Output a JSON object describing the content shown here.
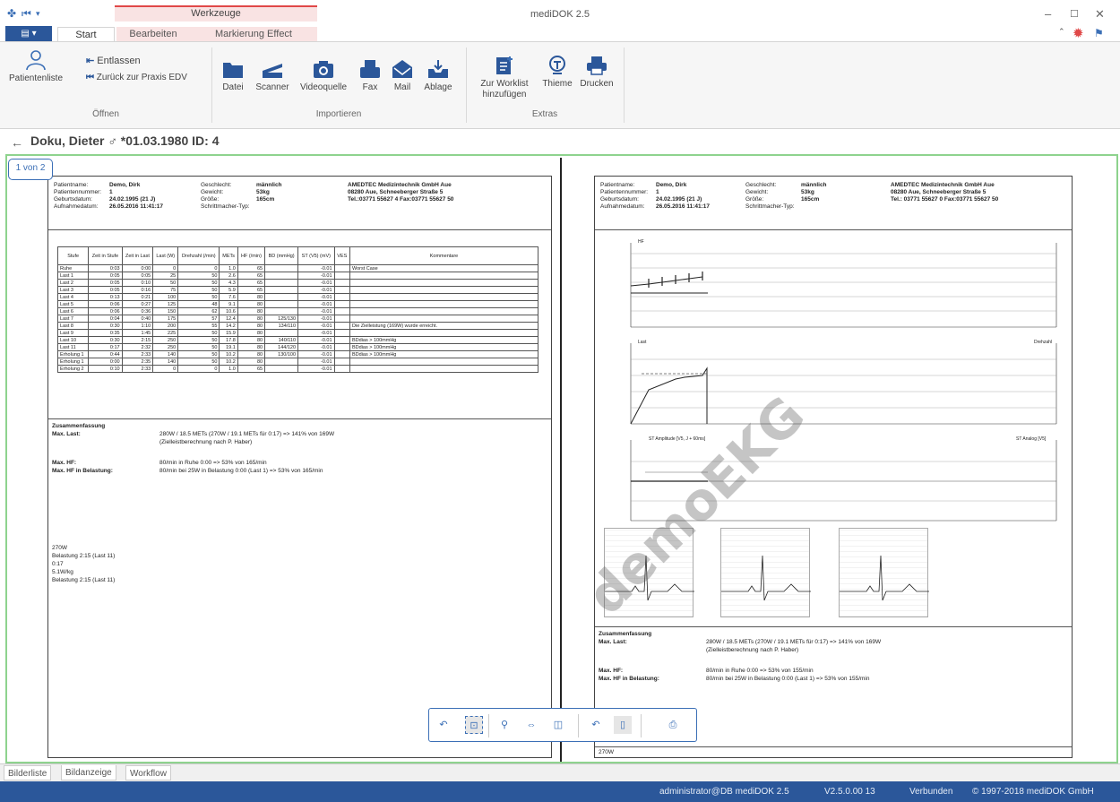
{
  "app_title": "mediDOK 2.5",
  "context_group": "Werkzeuge",
  "tabs": {
    "start": "Start",
    "bearbeiten": "Bearbeiten",
    "markierung": "Markierung Effect"
  },
  "ribbon": {
    "patientenliste": "Patientenliste",
    "entlassen": "Entlassen",
    "zurueck": "Zurück zur Praxis EDV",
    "oeffnen": "Öffnen",
    "datei": "Datei",
    "scanner": "Scanner",
    "videoquelle": "Videoquelle",
    "fax": "Fax",
    "mail": "Mail",
    "ablage": "Ablage",
    "importieren": "Importieren",
    "worklist": "Zur Worklist hinzufügen",
    "thieme": "Thieme",
    "drucken": "Drucken",
    "extras": "Extras"
  },
  "patient": {
    "title": "Doku, Dieter  ♂ *01.03.1980  ID: 4"
  },
  "viewer": {
    "page_indicator": "1 von 2",
    "watermark": "demoEKG"
  },
  "doc_left": {
    "patient_info": [
      [
        "Patientname:",
        "Demo, Dirk"
      ],
      [
        "Patientennummer:",
        "1"
      ],
      [
        "Geburtsdatum:",
        "24.02.1995 (21 J)"
      ],
      [
        "Aufnahmedatum:",
        "26.05.2016 11:41:17"
      ]
    ],
    "patient_info2": [
      [
        "Geschlecht:",
        "männlich"
      ],
      [
        "Gewicht:",
        "53kg"
      ],
      [
        "Größe:",
        "165cm"
      ],
      [
        "Schrittmacher-Typ:",
        ""
      ]
    ],
    "clinic": [
      "AMEDTEC Medizintechnik GmbH Aue",
      "08280 Aue, Schneeberger Straße 5",
      "Tel.:03771 55627 4     Fax:03771 55627 50"
    ],
    "table_headers": [
      "Stufe",
      "Zeit in Stufe",
      "Zeit in Last",
      "Last (W)",
      "Drehzahl (/min)",
      "METs",
      "HF (/min)",
      "BD (mmHg)",
      "ST (V5) (mV)",
      "VES",
      "Kommentare"
    ],
    "table_rows": [
      [
        "Ruhe",
        "0:03",
        "0:00",
        "0",
        "0",
        "1.0",
        "65",
        "",
        "-0.01",
        "",
        "Worst Case"
      ],
      [
        "Last 1",
        "0:05",
        "0:05",
        "25",
        "50",
        "2.6",
        "65",
        "",
        "-0.01",
        "",
        ""
      ],
      [
        "Last 2",
        "0:05",
        "0:10",
        "50",
        "50",
        "4.3",
        "65",
        "",
        "-0.01",
        "",
        ""
      ],
      [
        "Last 3",
        "0:05",
        "0:16",
        "75",
        "50",
        "5.9",
        "65",
        "",
        "-0.01",
        "",
        ""
      ],
      [
        "Last 4",
        "0:13",
        "0:21",
        "100",
        "50",
        "7.6",
        "80",
        "",
        "-0.01",
        "",
        ""
      ],
      [
        "Last 5",
        "0:06",
        "0:27",
        "125",
        "48",
        "9.1",
        "80",
        "",
        "-0.01",
        "",
        ""
      ],
      [
        "Last 6",
        "0:06",
        "0:36",
        "150",
        "62",
        "10.6",
        "80",
        "",
        "-0.01",
        "",
        ""
      ],
      [
        "Last 7",
        "0:04",
        "0:40",
        "175",
        "57",
        "12.4",
        "80",
        "125/130",
        "-0.01",
        "",
        ""
      ],
      [
        "Last 8",
        "0:30",
        "1:10",
        "200",
        "55",
        "14.2",
        "80",
        "134/110",
        "-0.01",
        "",
        "Die Zielleistung (169W) wurde erreicht."
      ],
      [
        "Last 9",
        "0:35",
        "1:45",
        "225",
        "50",
        "15.9",
        "80",
        "",
        "-0.01",
        "",
        ""
      ],
      [
        "Last 10",
        "0:30",
        "2:15",
        "250",
        "50",
        "17.8",
        "80",
        "140/110",
        "-0.01",
        "",
        "BDdias > 100mmHg"
      ],
      [
        "Last 11",
        "0:17",
        "2:32",
        "250",
        "50",
        "19.1",
        "80",
        "144/120",
        "-0.01",
        "",
        "BDdias > 100mmHg"
      ],
      [
        "Erholung 1",
        "0:44",
        "2:33",
        "140",
        "50",
        "10.2",
        "80",
        "130/100",
        "-0.01",
        "",
        "BDdias > 100mmHg"
      ],
      [
        "Erholung 1",
        "0:00",
        "2:35",
        "140",
        "50",
        "10.2",
        "80",
        "",
        "-0.01",
        "",
        ""
      ],
      [
        "Erholung 2",
        "0:10",
        "2:33",
        "0",
        "0",
        "1.0",
        "65",
        "",
        "-0.01",
        "",
        ""
      ]
    ],
    "summary_title": "Zusammenfassung",
    "summary": [
      [
        "Max. Last:",
        "280W  /  18.5 METs (270W / 19.1 METs für 0:17) => 141% von 169W"
      ],
      [
        "",
        "(Zielleistberechnung nach P. Haber)"
      ],
      [
        "Max. HF:",
        "80/min in Ruhe 0:00 => 53% von 165/min"
      ],
      [
        "Max. HF in Belastung:",
        "80/min bei 25W in Belastung 0:00 (Last 1) => 53% von 165/min"
      ]
    ],
    "extra": [
      "270W",
      "Belastung 2:15 (Last 11)",
      "0:17",
      "5.1W/kg",
      "Belastung 2:15 (Last 11)"
    ]
  },
  "doc_right": {
    "patient_info": [
      [
        "Patientname:",
        "Demo, Dirk"
      ],
      [
        "Patientennummer:",
        "1"
      ],
      [
        "Geburtsdatum:",
        "24.02.1995 (21 J)"
      ],
      [
        "Aufnahmedatum:",
        "26.05.2016 11:41:17"
      ]
    ],
    "patient_info2": [
      [
        "Geschlecht:",
        "männlich"
      ],
      [
        "Gewicht:",
        "53kg"
      ],
      [
        "Größe:",
        "165cm"
      ],
      [
        "Schrittmacher-Typ:",
        ""
      ]
    ],
    "clinic": [
      "AMEDTEC Medizintechnik GmbH Aue",
      "08280 Aue, Schneeberger Straße 5",
      "Tel.: 03771 55627 0     Fax:03771 55627 50"
    ],
    "chart1_label": "HF",
    "chart2_label": "Last",
    "chart2_right": "Drehzahl",
    "chart3_label": "ST Amplitude [V5, J + 60ms]",
    "chart3_right": "ST Analog [V5]",
    "summary_title": "Zusammenfassung",
    "summary": [
      [
        "Max. Last:",
        "280W  /  18.5 METs (270W / 19.1 METs für 0:17) => 141% von 169W"
      ],
      [
        "",
        "(Zielleistberechnung nach P. Haber)"
      ],
      [
        "Max. HF:",
        "80/min in Ruhe 0:00 => 53% von 155/min"
      ],
      [
        "Max. HF in Belastung:",
        "80/min bei 25W in Belastung 0:00 (Last 1) => 53% von 155/min"
      ]
    ],
    "extra": "270W"
  },
  "bottom_tabs": [
    "Bilderliste",
    "Bildanzeige",
    "Workflow"
  ],
  "status": {
    "user": "administrator@DB mediDOK 2.5",
    "version": "V2.5.0.00 13",
    "connection": "Verbunden",
    "copyright": "© 1997-2018 mediDOK GmbH"
  }
}
